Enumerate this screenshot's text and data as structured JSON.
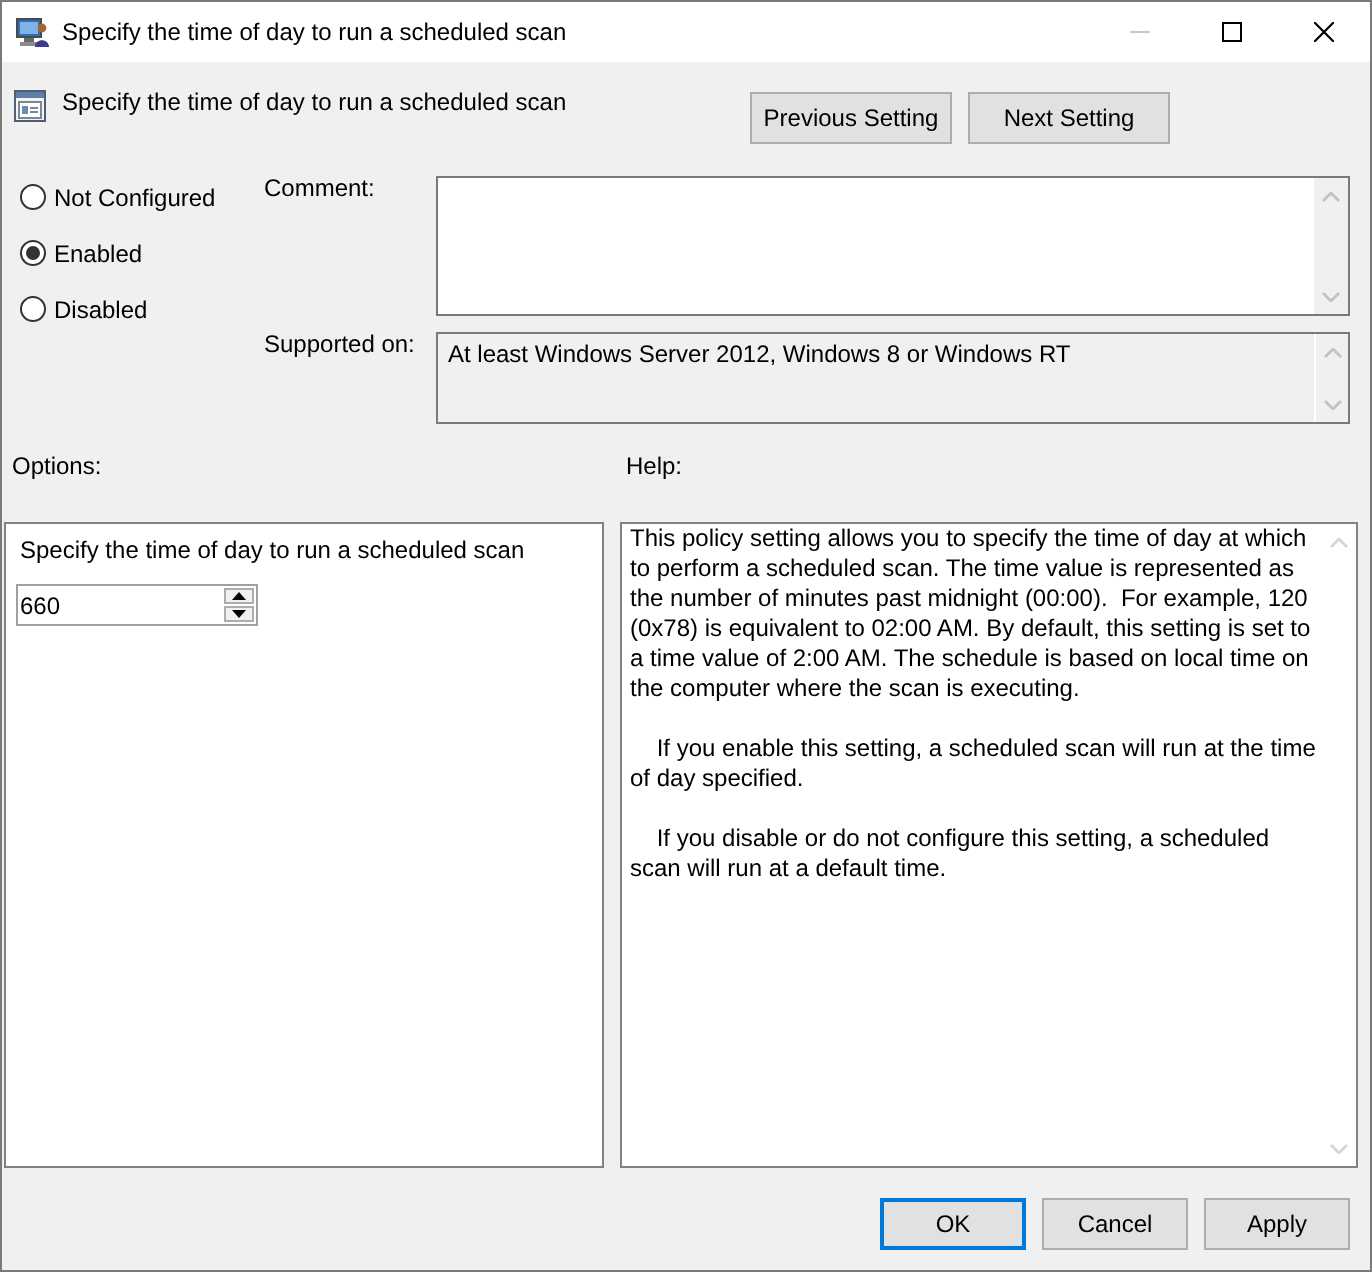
{
  "window": {
    "title": "Specify the time of day to run a scheduled scan",
    "controls": [
      {
        "kind": "minimize",
        "disabled": true
      },
      {
        "kind": "maximize",
        "disabled": false
      },
      {
        "kind": "close",
        "disabled": false
      }
    ]
  },
  "header": {
    "title": "Specify the time of day to run a scheduled scan",
    "buttons": [
      "Previous Setting",
      "Next Setting"
    ]
  },
  "state_options": [
    {
      "label": "Not Configured",
      "selected": false
    },
    {
      "label": "Enabled",
      "selected": true
    },
    {
      "label": "Disabled",
      "selected": false
    }
  ],
  "comment": {
    "label": "Comment:"
  },
  "supported_on": {
    "label": "Supported on:",
    "value": "At least Windows Server 2012, Windows 8 or Windows RT"
  },
  "options": {
    "label": "Options:",
    "setting_label": "Specify the time of day to run a scheduled scan",
    "value": "660"
  },
  "help": {
    "label": "Help:",
    "paragraphs": [
      "This policy setting allows you to specify the time of day at which to perform a scheduled scan. The time value is represented as the number of minutes past midnight (00:00).  For example, 120 (0x78) is equivalent to 02:00 AM. By default, this setting is set to a time value of 2:00 AM. The schedule is based on local time on the computer where the scan is executing.",
      "    If you enable this setting, a scheduled scan will run at the time of day specified.",
      "    If you disable or do not configure this setting, a scheduled scan will run at a default time."
    ]
  },
  "buttons": [
    {
      "label": "OK",
      "default": true
    },
    {
      "label": "Cancel",
      "default": false
    },
    {
      "label": "Apply",
      "default": false
    }
  ]
}
